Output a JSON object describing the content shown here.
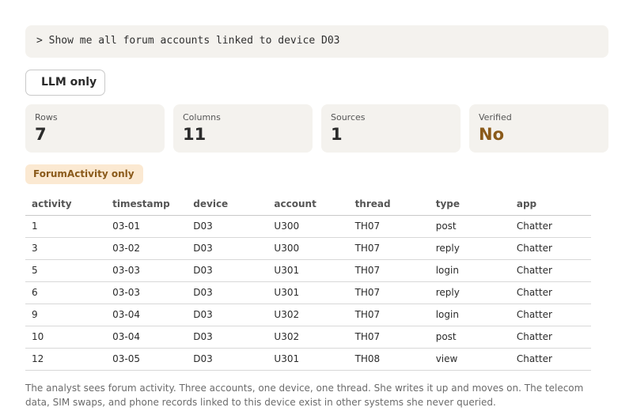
{
  "query": {
    "text": "> Show me all forum accounts linked to device D03"
  },
  "mode_badge": "LLM only",
  "stats": [
    {
      "label": "Rows",
      "value": "7"
    },
    {
      "label": "Columns",
      "value": "11"
    },
    {
      "label": "Sources",
      "value": "1"
    },
    {
      "label": "Verified",
      "value": "No"
    }
  ],
  "scope_badge": "ForumActivity only",
  "table": {
    "columns": [
      "activity",
      "timestamp",
      "device",
      "account",
      "thread",
      "type",
      "app"
    ],
    "rows": [
      [
        "1",
        "03-01",
        "D03",
        "U300",
        "TH07",
        "post",
        "Chatter"
      ],
      [
        "3",
        "03-02",
        "D03",
        "U300",
        "TH07",
        "reply",
        "Chatter"
      ],
      [
        "5",
        "03-03",
        "D03",
        "U301",
        "TH07",
        "login",
        "Chatter"
      ],
      [
        "6",
        "03-03",
        "D03",
        "U301",
        "TH07",
        "reply",
        "Chatter"
      ],
      [
        "9",
        "03-04",
        "D03",
        "U302",
        "TH07",
        "login",
        "Chatter"
      ],
      [
        "10",
        "03-04",
        "D03",
        "U302",
        "TH07",
        "post",
        "Chatter"
      ],
      [
        "12",
        "03-05",
        "D03",
        "U301",
        "TH08",
        "view",
        "Chatter"
      ]
    ]
  },
  "narrative": "The analyst sees forum activity. Three accounts, one device, one thread. She writes it up and moves on. The telecom data, SIM swaps, and phone records linked to this device exist in other systems she never queried.",
  "colors": {
    "panel_bg": "#f4f2ee",
    "warn": "#8a5a1a",
    "badge_bg": "#fbe9d2"
  }
}
